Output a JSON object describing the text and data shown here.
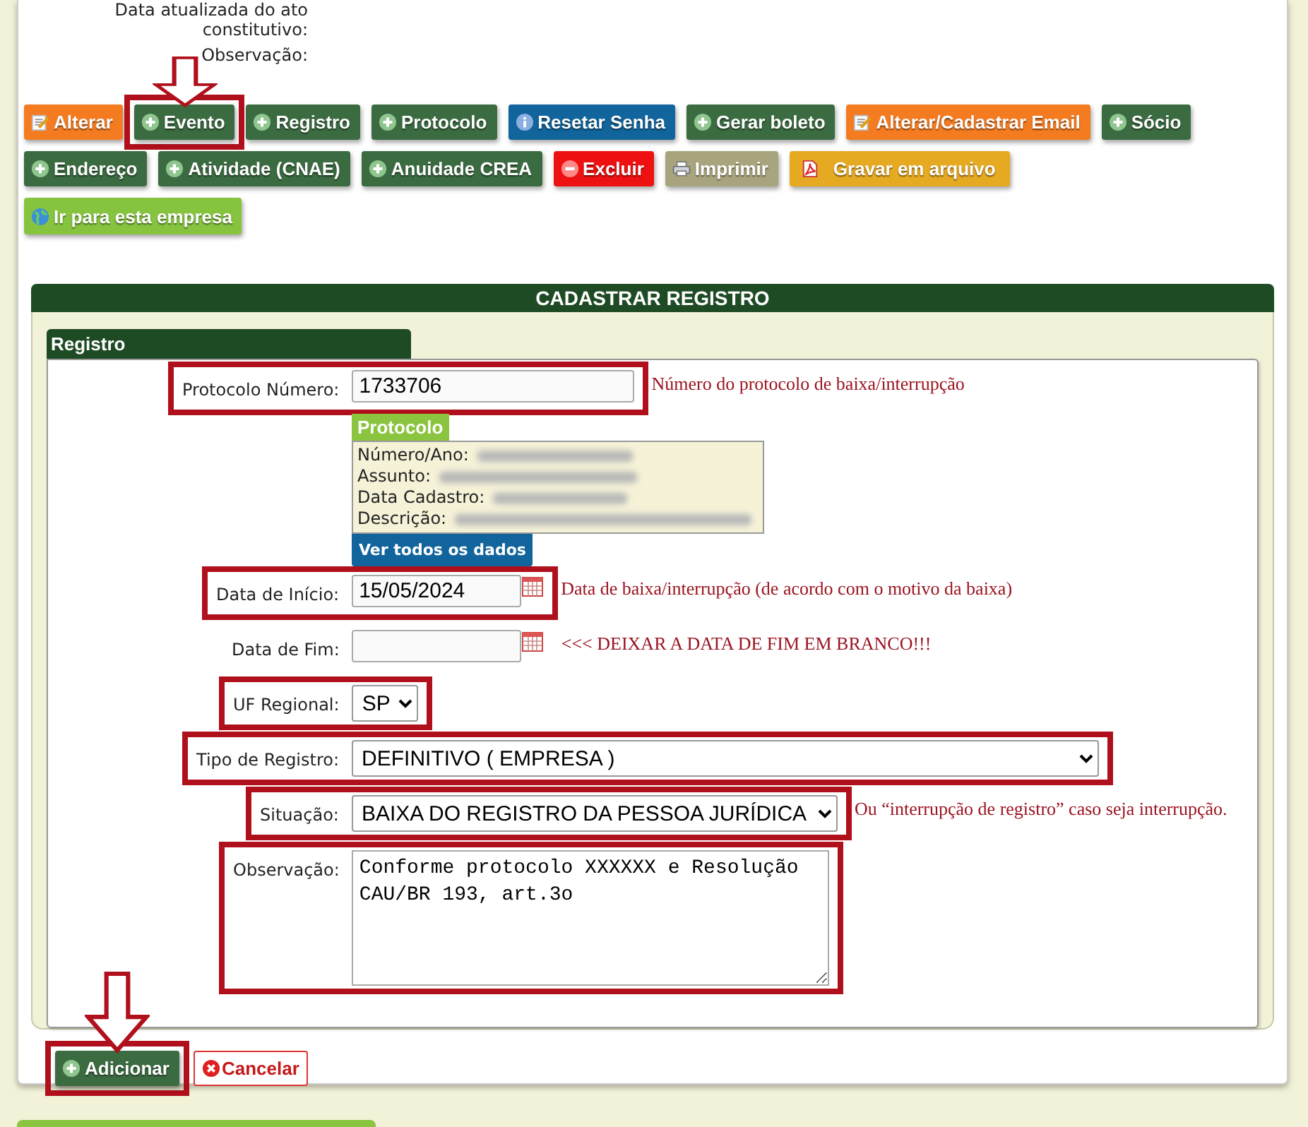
{
  "record_details": [
    {
      "label": "Data atualizada do ato constitutivo:"
    },
    {
      "label": "Observação:"
    }
  ],
  "actions": [
    [
      {
        "label": "Alterar",
        "kind": "edit",
        "highlighted": false,
        "arrow": false
      },
      {
        "label": "Evento",
        "kind": "add",
        "highlighted": true,
        "arrow": true
      },
      {
        "label": "Registro",
        "kind": "add",
        "highlighted": false,
        "arrow": false
      },
      {
        "label": "Protocolo",
        "kind": "add",
        "highlighted": false,
        "arrow": false
      },
      {
        "label": "Resetar Senha",
        "kind": "info",
        "highlighted": false,
        "arrow": false
      },
      {
        "label": "Gerar boleto",
        "kind": "add",
        "highlighted": false,
        "arrow": false
      },
      {
        "label": "Alterar/Cadastrar Email",
        "kind": "edit",
        "highlighted": false,
        "arrow": false
      },
      {
        "label": "Sócio",
        "kind": "add",
        "highlighted": false,
        "arrow": false
      }
    ],
    [
      {
        "label": "Endereço",
        "kind": "add",
        "highlighted": false,
        "arrow": false
      },
      {
        "label": "Atividade (CNAE)",
        "kind": "add",
        "highlighted": false,
        "arrow": false
      },
      {
        "label": "Anuidade CREA",
        "kind": "add",
        "highlighted": false,
        "arrow": false
      },
      {
        "label": "Excluir",
        "kind": "delete",
        "highlighted": false,
        "arrow": false
      },
      {
        "label": "Imprimir",
        "kind": "print",
        "highlighted": false,
        "arrow": false
      },
      {
        "label": "Gravar em arquivo",
        "kind": "pdf",
        "highlighted": false,
        "arrow": false
      }
    ],
    [
      {
        "label": "Ir para esta empresa",
        "kind": "globe",
        "highlighted": false,
        "arrow": false
      }
    ]
  ],
  "form": {
    "title": "CADASTRAR REGISTRO",
    "section_tab": "Registro",
    "fields": [
      {
        "kind": "text",
        "label": "Protocolo Número:",
        "value": "1733706",
        "highlighted": true,
        "note": "Número do protocolo de baixa/interrupção",
        "protocol_panel": {
          "title": "Protocolo",
          "lines": [
            "Número/Ano:",
            "Assunto:",
            "Data Cadastro:",
            "Descrição:"
          ],
          "link": "Ver todos os dados"
        }
      },
      {
        "kind": "date",
        "label": "Data de Início:",
        "value": "15/05/2024",
        "highlighted": true,
        "note": "Data de baixa/interrupção (de acordo com o motivo da baixa)"
      },
      {
        "kind": "date",
        "label": "Data de Fim:",
        "highlighted": false,
        "note": "<<< DEIXAR A DATA DE FIM EM BRANCO!!!"
      },
      {
        "kind": "select",
        "label": "UF Regional:",
        "value": "SP",
        "highlighted": true,
        "wide": false
      },
      {
        "kind": "select",
        "label": "Tipo de Registro:",
        "value": "DEFINITIVO ( EMPRESA )",
        "highlighted": true,
        "wide": true
      },
      {
        "kind": "select",
        "label": "Situação:",
        "value": "BAIXA DO REGISTRO DA PESSOA JURÍDICA",
        "highlighted": true,
        "wide": false,
        "note": "Ou “interrupção de registro” caso seja interrupção."
      },
      {
        "kind": "textarea",
        "label": "Observação:",
        "value": "Conforme protocolo XXXXXX e Resolução CAU/BR 193, art.3o",
        "highlighted": true
      }
    ],
    "buttons": [
      {
        "label": "Adicionar",
        "kind": "add",
        "highlighted": true,
        "arrow": true
      },
      {
        "label": "Cancelar",
        "kind": "cancel",
        "highlighted": false,
        "arrow": false
      }
    ]
  }
}
